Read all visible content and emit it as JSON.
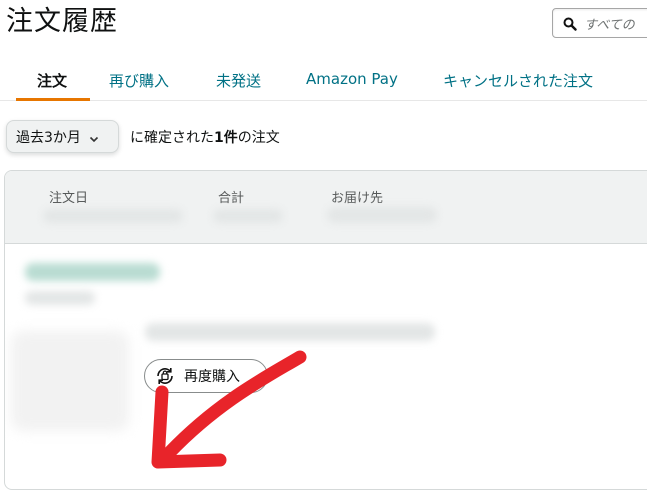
{
  "page": {
    "title": "注文履歴"
  },
  "search": {
    "placeholder": "すべての"
  },
  "tabs": [
    {
      "label": "注文",
      "active": true
    },
    {
      "label": "再び購入",
      "active": false
    },
    {
      "label": "未発送",
      "active": false
    },
    {
      "label": "Amazon Pay",
      "active": false
    },
    {
      "label": "キャンセルされた注文",
      "active": false
    }
  ],
  "filter": {
    "period": "過去3か月",
    "summary_prefix": "に確定された",
    "summary_count": "1件",
    "summary_suffix": "の注文"
  },
  "order": {
    "columns": {
      "order_date": "注文日",
      "total": "合計",
      "ship_to": "お届け先"
    },
    "rebuy_label": "再度購入"
  },
  "icons": [
    "search-icon",
    "chevron-down-icon",
    "rebuy-icon"
  ],
  "colors": {
    "accent": "#e77600",
    "link": "#007185",
    "annotation_arrow": "#e8242a"
  }
}
